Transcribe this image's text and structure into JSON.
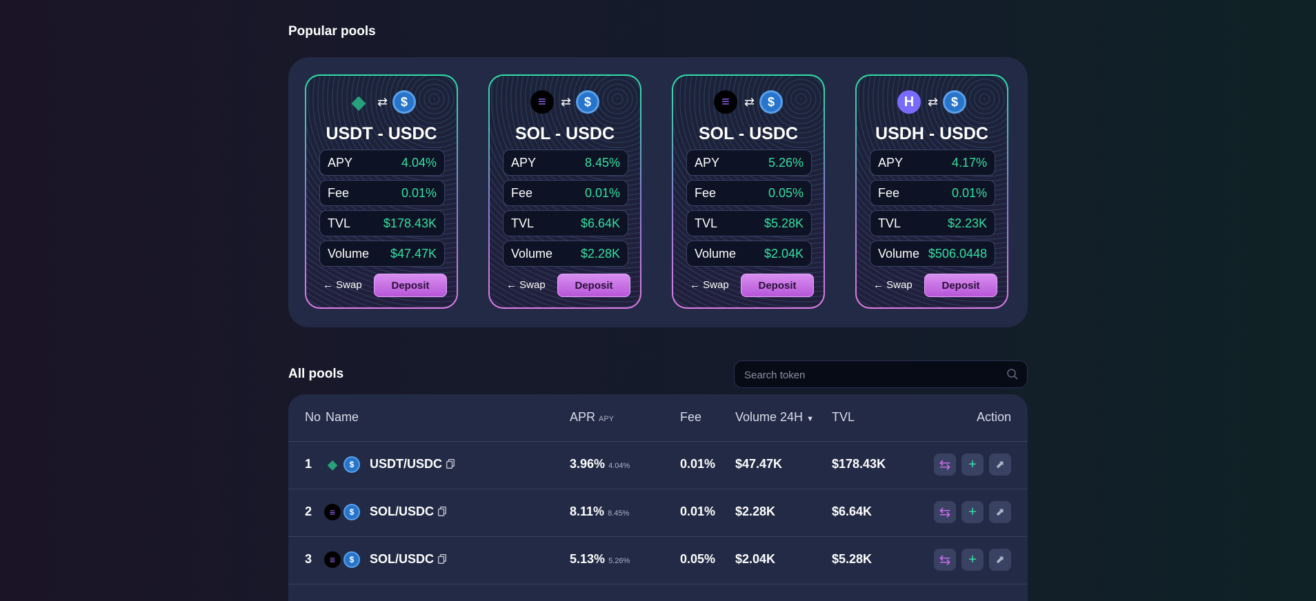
{
  "popular": {
    "title": "Popular pools",
    "cards": [
      {
        "icon1": "usdt-icon",
        "icon2": "usdc-icon",
        "name": "USDT - USDC",
        "apy_label": "APY",
        "apy": "4.04%",
        "fee_label": "Fee",
        "fee": "0.01%",
        "tvl_label": "TVL",
        "tvl": "$178.43K",
        "volume_label": "Volume",
        "volume": "$47.47K",
        "swap_label": "Swap",
        "deposit_label": "Deposit"
      },
      {
        "icon1": "sol-icon",
        "icon2": "usdc-icon",
        "name": "SOL - USDC",
        "apy_label": "APY",
        "apy": "8.45%",
        "fee_label": "Fee",
        "fee": "0.01%",
        "tvl_label": "TVL",
        "tvl": "$6.64K",
        "volume_label": "Volume",
        "volume": "$2.28K",
        "swap_label": "Swap",
        "deposit_label": "Deposit"
      },
      {
        "icon1": "sol-icon",
        "icon2": "usdc-icon",
        "name": "SOL - USDC",
        "apy_label": "APY",
        "apy": "5.26%",
        "fee_label": "Fee",
        "fee": "0.05%",
        "tvl_label": "TVL",
        "tvl": "$5.28K",
        "volume_label": "Volume",
        "volume": "$2.04K",
        "swap_label": "Swap",
        "deposit_label": "Deposit"
      },
      {
        "icon1": "usdh-icon",
        "icon2": "usdc-icon",
        "name": "USDH - USDC",
        "apy_label": "APY",
        "apy": "4.17%",
        "fee_label": "Fee",
        "fee": "0.01%",
        "tvl_label": "TVL",
        "tvl": "$2.23K",
        "volume_label": "Volume",
        "volume": "$506.0448",
        "swap_label": "Swap",
        "deposit_label": "Deposit"
      }
    ]
  },
  "all_pools": {
    "title": "All pools",
    "search_placeholder": "Search token",
    "headers": {
      "no": "No",
      "name": "Name",
      "apr": "APR",
      "apr_sub": "APY",
      "fee": "Fee",
      "volume": "Volume 24H",
      "tvl": "TVL",
      "action": "Action"
    },
    "rows": [
      {
        "no": "1",
        "icon1": "usdt-icon",
        "icon2": "usdc-icon",
        "name": "USDT/USDC",
        "apr": "3.96%",
        "apy": "4.04%",
        "fee": "0.01%",
        "volume": "$47.47K",
        "tvl": "$178.43K"
      },
      {
        "no": "2",
        "icon1": "sol-icon",
        "icon2": "usdc-icon",
        "name": "SOL/USDC",
        "apr": "8.11%",
        "apy": "8.45%",
        "fee": "0.01%",
        "volume": "$2.28K",
        "tvl": "$6.64K"
      },
      {
        "no": "3",
        "icon1": "sol-icon",
        "icon2": "usdc-icon",
        "name": "SOL/USDC",
        "apr": "5.13%",
        "apy": "5.26%",
        "fee": "0.05%",
        "volume": "$2.04K",
        "tvl": "$5.28K"
      }
    ]
  },
  "colors": {
    "accent_green": "#35e0a1",
    "accent_purple": "#c66ce6",
    "panel": "#232a45"
  }
}
